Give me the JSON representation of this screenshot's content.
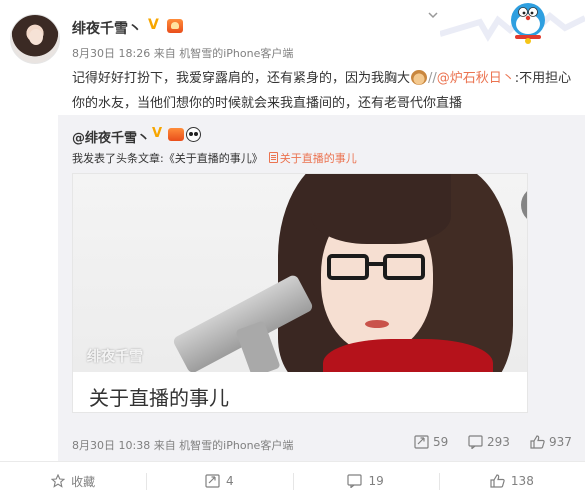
{
  "post": {
    "username": "绯夜千雪丶",
    "verified_mark": "V",
    "meta": {
      "date": "8月30日 18:26",
      "from": "来自",
      "source": "机智雪的iPhone客户端"
    },
    "text": {
      "part1": "记得好好打扮下，我爱穿露肩的，还有紧身的，因为我胸大",
      "slashes": "//",
      "mention": "@炉石秋日丶",
      "part2": ":不用担心你的水友，当他们想你的时候就会来我直播间的，还有老哥代你直播"
    }
  },
  "repost": {
    "author": "@绯夜千雪丶",
    "verified_mark": "V",
    "line_prefix": "我发表了头条文章:",
    "article_link": "《关于直播的事儿》",
    "article_tag": "关于直播的事儿",
    "card": {
      "watermark": "绯夜千雪",
      "title": "关于直播的事儿"
    },
    "time": "8月30日 10:38 来自 机智雪的iPhone客户端",
    "stats": {
      "reposts": "59",
      "comments": "293",
      "likes": "937"
    }
  },
  "actions": {
    "favorite": "收藏",
    "repost": "4",
    "comment": "19",
    "like": "138"
  },
  "colors": {
    "link": "#eb7350",
    "verified": "#f7a600",
    "muted": "#808080",
    "repost_bg": "#f2f2f5"
  }
}
